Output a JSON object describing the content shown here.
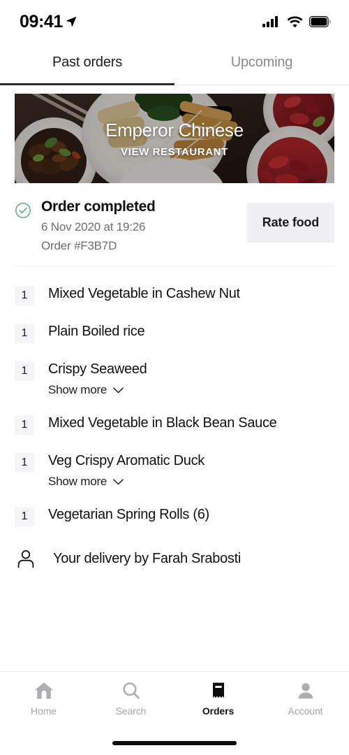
{
  "status_bar": {
    "time": "09:41",
    "location_icon": "location-arrow-icon",
    "signal_icon": "cellular-signal-icon",
    "wifi_icon": "wifi-icon",
    "battery_icon": "battery-full-icon"
  },
  "tabs": [
    {
      "label": "Past orders",
      "active": true
    },
    {
      "label": "Upcoming",
      "active": false
    }
  ],
  "banner": {
    "restaurant_name": "Emperor Chinese",
    "action_label": "VIEW RESTAURANT"
  },
  "order": {
    "status_icon": "check-circle-icon",
    "status_color": "#3fa96a",
    "status": "Order completed",
    "datetime": "6 Nov 2020 at 19:26",
    "order_id": "Order #F3B7D",
    "rate_button": "Rate food"
  },
  "items": [
    {
      "qty": "1",
      "name": "Mixed Vegetable in Cashew Nut",
      "show_more": null
    },
    {
      "qty": "1",
      "name": "Plain Boiled rice",
      "show_more": null
    },
    {
      "qty": "1",
      "name": "Crispy Seaweed",
      "show_more": "Show more"
    },
    {
      "qty": "1",
      "name": "Mixed Vegetable in Black Bean Sauce",
      "show_more": null
    },
    {
      "qty": "1",
      "name": "Veg Crispy Aromatic Duck",
      "show_more": "Show more"
    },
    {
      "qty": "1",
      "name": "Vegetarian Spring Rolls (6)",
      "show_more": null
    }
  ],
  "courier": {
    "icon": "person-outline-icon",
    "text": "Your delivery by Farah Srabosti"
  },
  "bottom_nav": [
    {
      "label": "Home",
      "icon": "home-icon",
      "active": false
    },
    {
      "label": "Search",
      "icon": "search-icon",
      "active": false
    },
    {
      "label": "Orders",
      "icon": "receipt-icon",
      "active": true
    },
    {
      "label": "Account",
      "icon": "account-icon",
      "active": false
    }
  ]
}
